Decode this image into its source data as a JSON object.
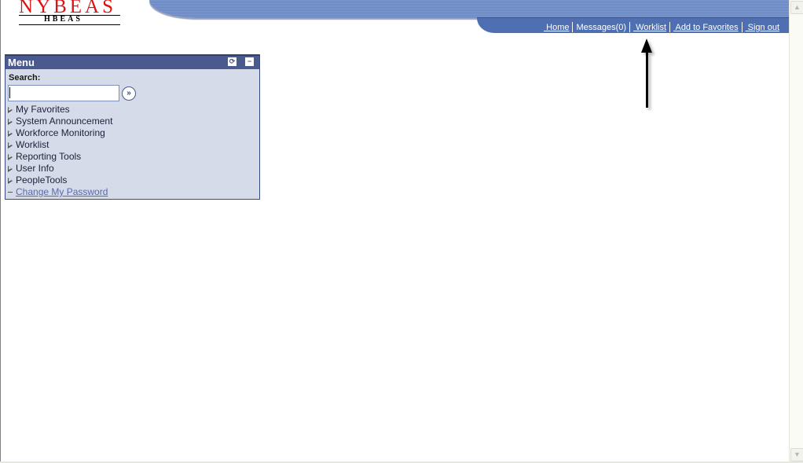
{
  "logo": {
    "title": "NYBEAS",
    "subtitle": "HBEAS"
  },
  "header_nav": {
    "links": [
      {
        "label": " Home",
        "underline": true
      },
      {
        "label": "Messages(0)",
        "underline": false
      },
      {
        "label": " Worklist",
        "underline": true
      },
      {
        "label": " Add to Favorites",
        "underline": true
      },
      {
        "label": " Sign out",
        "underline": true
      }
    ]
  },
  "menu": {
    "title": "Menu",
    "refresh_icon": "refresh-icon",
    "minimize_icon": "minimize-icon",
    "search_label": "Search:",
    "search_value": "",
    "go_icon": "double-chevron-right",
    "items": [
      {
        "label": "My Favorites",
        "type": "folder"
      },
      {
        "label": "System Announcement",
        "type": "folder"
      },
      {
        "label": "Workforce Monitoring",
        "type": "folder"
      },
      {
        "label": "Worklist",
        "type": "folder"
      },
      {
        "label": "Reporting Tools",
        "type": "folder"
      },
      {
        "label": "User Info",
        "type": "folder"
      },
      {
        "label": "PeopleTools",
        "type": "folder"
      },
      {
        "label": "Change My Password",
        "type": "link"
      }
    ]
  },
  "annotation": {
    "arrow_target": "Worklist"
  },
  "colors": {
    "banner": "#6a88c4",
    "navbar": "#4e6fb1",
    "menu_header": "#4a5a8f",
    "menu_bg": "#d5dbe8",
    "logo_red": "#dd1111"
  }
}
